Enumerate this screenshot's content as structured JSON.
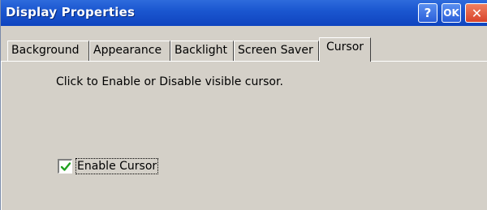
{
  "window": {
    "title": "Display Properties"
  },
  "titlebar_buttons": {
    "help": "?",
    "ok": "OK",
    "close": "✕"
  },
  "tabs": [
    {
      "label": "Background",
      "active": false
    },
    {
      "label": "Appearance",
      "active": false
    },
    {
      "label": "Backlight",
      "active": false
    },
    {
      "label": "Screen Saver",
      "active": false
    },
    {
      "label": "Cursor",
      "active": true
    }
  ],
  "cursor_tab": {
    "description": "Click to Enable or Disable visible cursor.",
    "enable_cursor": {
      "label": "Enable Cursor",
      "checked": true
    }
  },
  "colors": {
    "titlebar": "#1b57d0",
    "panel": "#d4d0c8",
    "checkmark": "#21a121",
    "close_button": "#d8432a"
  }
}
